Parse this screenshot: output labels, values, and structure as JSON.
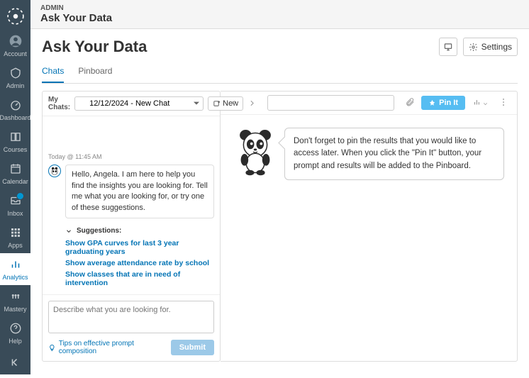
{
  "header": {
    "crumb": "ADMIN",
    "title": "Ask Your Data"
  },
  "sidebar": {
    "items": [
      {
        "id": "account",
        "label": "Account"
      },
      {
        "id": "admin",
        "label": "Admin"
      },
      {
        "id": "dashboard",
        "label": "Dashboard"
      },
      {
        "id": "courses",
        "label": "Courses"
      },
      {
        "id": "calendar",
        "label": "Calendar"
      },
      {
        "id": "inbox",
        "label": "Inbox"
      },
      {
        "id": "apps",
        "label": "Apps"
      },
      {
        "id": "analytics",
        "label": "Analytics"
      },
      {
        "id": "mastery",
        "label": "Mastery"
      },
      {
        "id": "help",
        "label": "Help"
      }
    ]
  },
  "page": {
    "title": "Ask Your Data",
    "settings_label": "Settings",
    "tabs": [
      {
        "id": "chats",
        "label": "Chats"
      },
      {
        "id": "pinboard",
        "label": "Pinboard"
      }
    ]
  },
  "chats": {
    "my_chats_label": "My Chats:",
    "selected_chat": "12/12/2024 - New Chat",
    "new_label": "New",
    "timestamp": "Today @ 11:45 AM",
    "greeting": "Hello, Angela.  I am here to help you find the insights you are looking for.  Tell me what you are looking for, or try one of these suggestions.",
    "suggestions_header": "Suggestions:",
    "suggestions": [
      "Show GPA curves for last 3 year graduating years",
      "Show average attendance rate by school",
      "Show classes that are in need of intervention"
    ],
    "prompt_placeholder": "Describe what you are looking for.",
    "tips_link": "Tips on effective prompt composition",
    "submit_label": "Submit"
  },
  "results": {
    "pin_label": "Pin It",
    "intro_message": "Don't forget to pin the results that you would like to access later.  When you click the \"Pin It\" button, your prompt and results will be added to the Pinboard."
  },
  "colors": {
    "brand": "#0374b5",
    "pin": "#56bdf2",
    "sidebar": "#394b58"
  }
}
